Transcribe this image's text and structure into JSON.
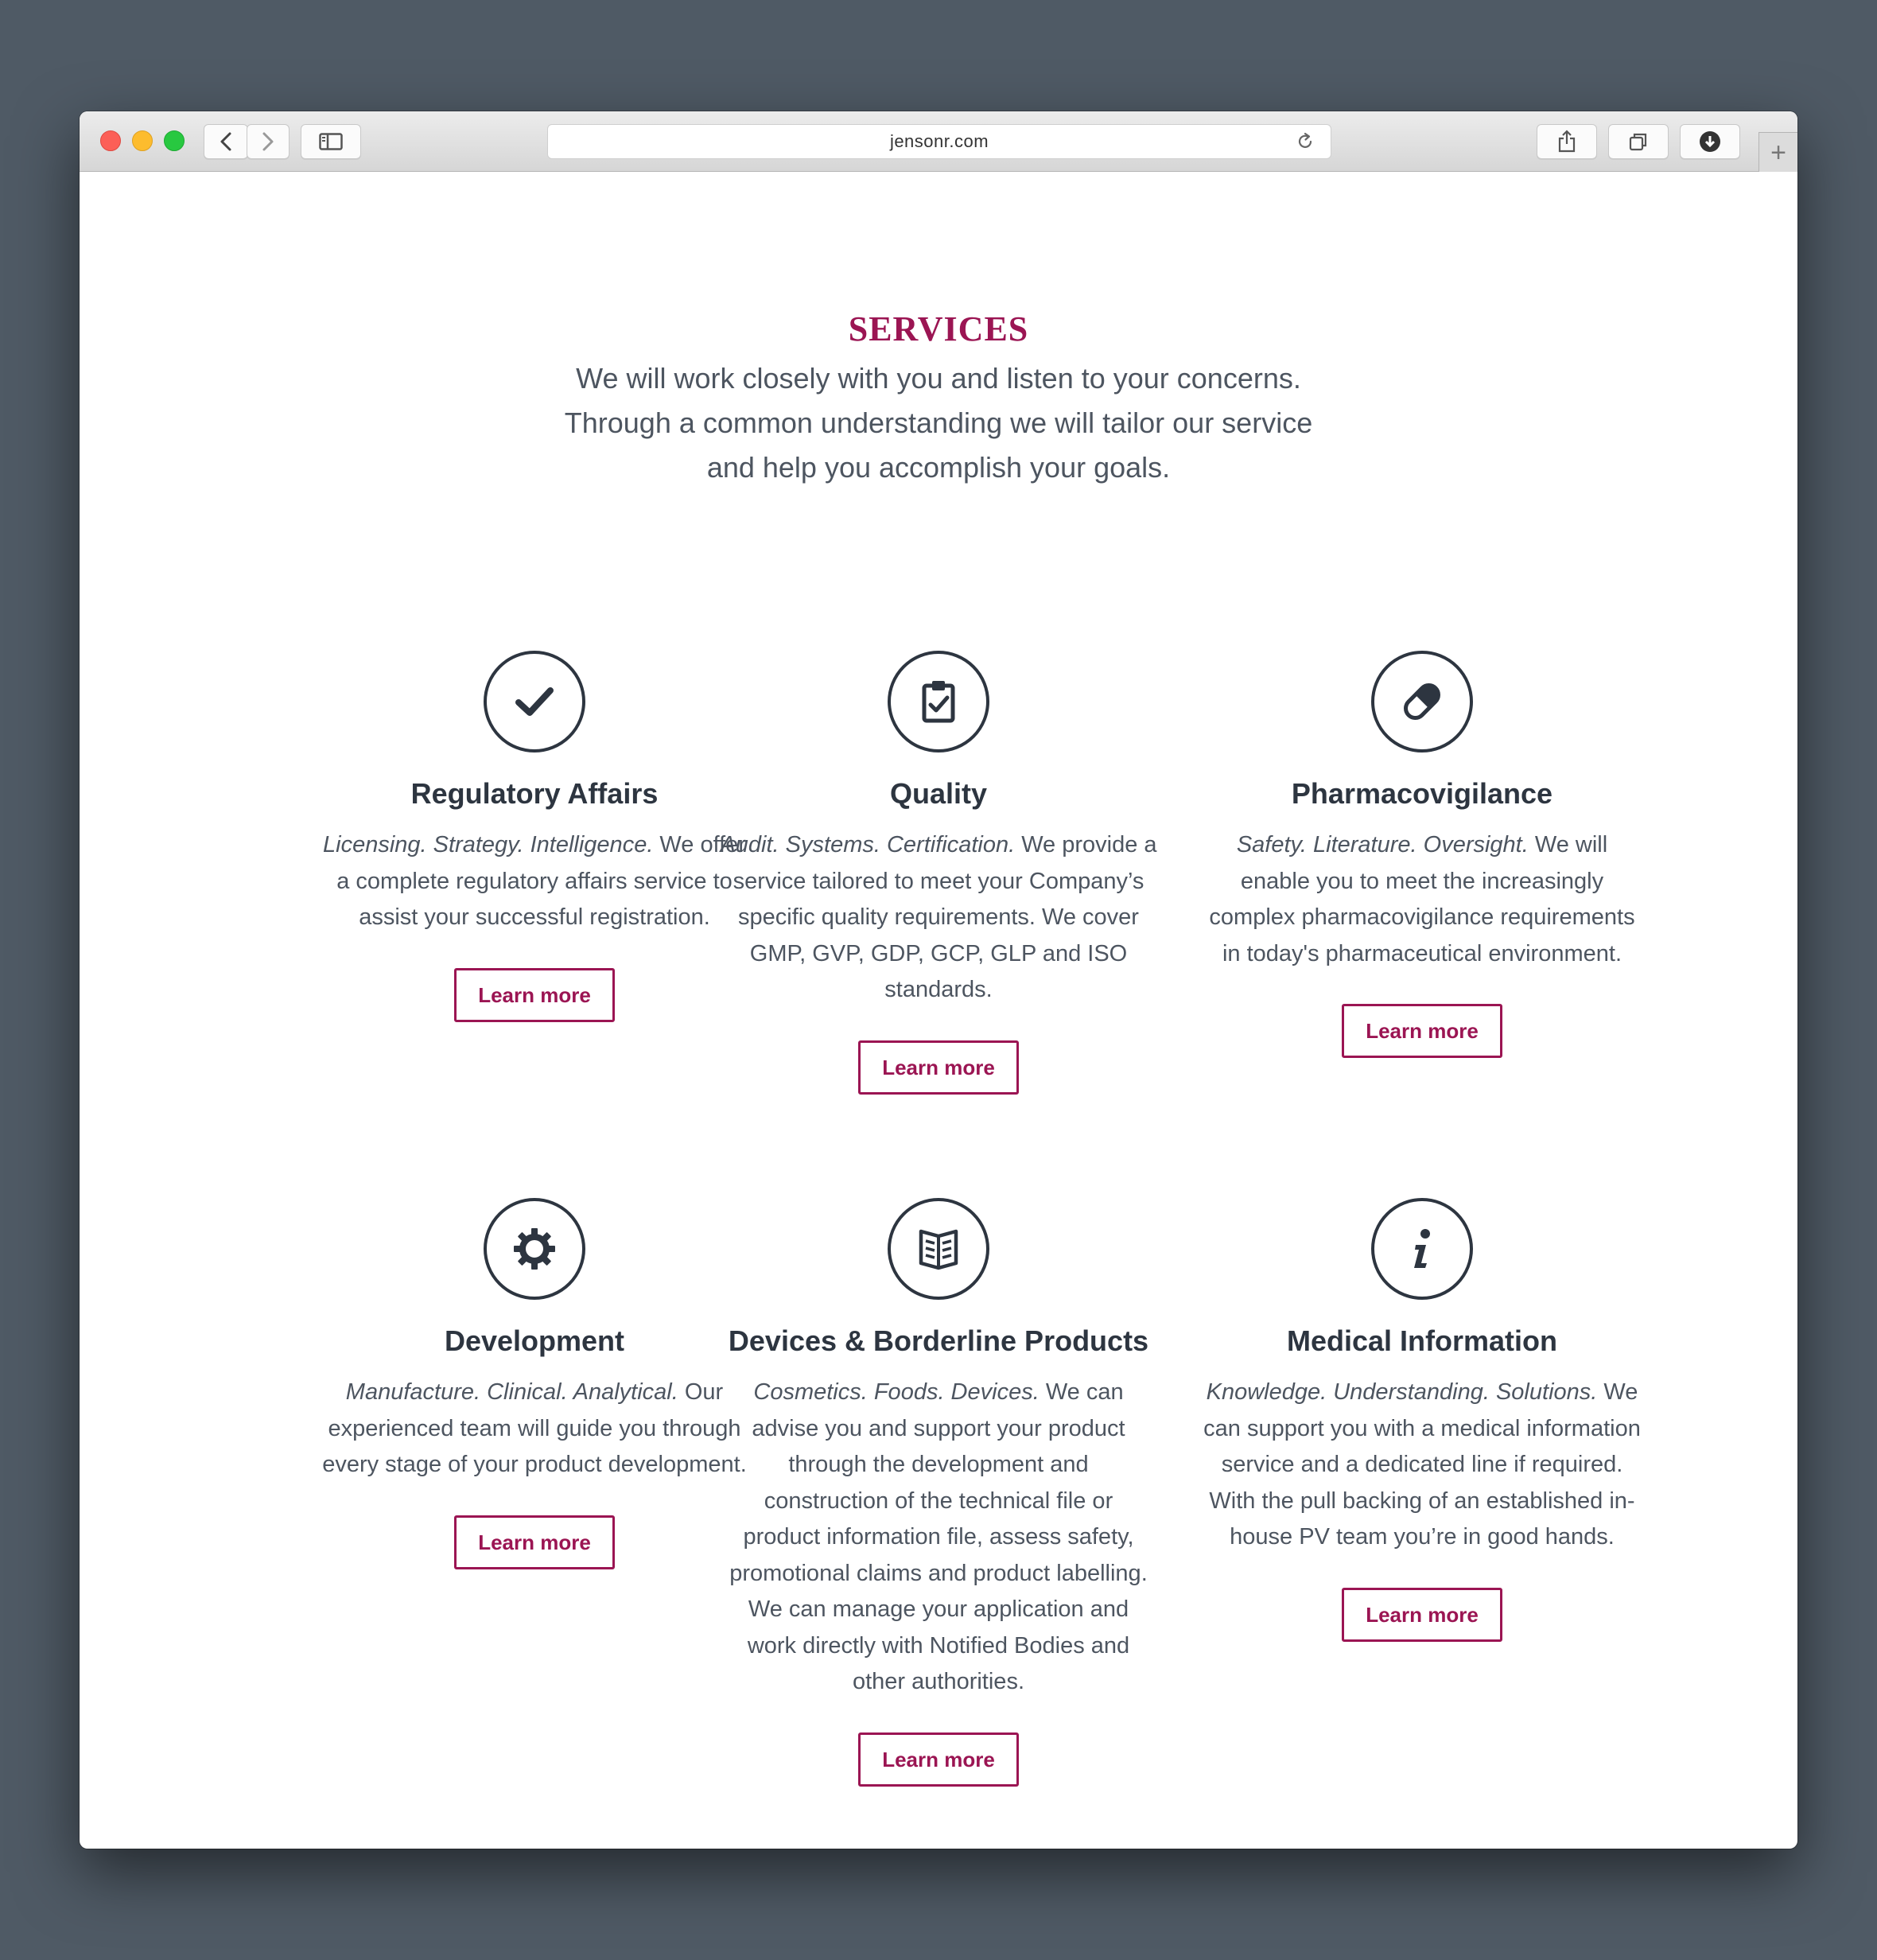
{
  "browser": {
    "url": "jensonr.com",
    "new_tab": "+"
  },
  "page": {
    "heading": "SERVICES",
    "intro": "We will work closely with you and listen to your concerns. Through a common understanding we will tailor our service and help you accomplish your goals."
  },
  "services": [
    {
      "icon": "check-icon",
      "title": "Regulatory Affairs",
      "tagline": "Licensing. Strategy. Intelligence.",
      "description": " We offer a complete regulatory affairs service to assist your successful registration.",
      "button": "Learn more"
    },
    {
      "icon": "clipboard-check-icon",
      "title": "Quality",
      "tagline": "Audit. Systems. Certification.",
      "description": " We provide a service tailored to meet your Company’s specific quality requirements. We cover GMP, GVP, GDP, GCP, GLP and ISO standards.",
      "button": "Learn more"
    },
    {
      "icon": "pill-icon",
      "title": "Pharmacovigilance",
      "tagline": "Safety. Literature. Oversight.",
      "description": " We will enable you to meet the increasingly complex pharmacovigilance requirements in today's pharmaceutical environment.",
      "button": "Learn more"
    },
    {
      "icon": "gear-icon",
      "title": "Development",
      "tagline": "Manufacture. Clinical. Analytical.",
      "description": " Our experienced team will guide you through every stage of your product development.",
      "button": "Learn more"
    },
    {
      "icon": "book-icon",
      "title": "Devices & Borderline Products",
      "tagline": "Cosmetics. Foods. Devices.",
      "description": " We can advise you and support your product through the development and construction of the technical file or product information file, assess safety, promotional claims and product labelling. We can manage your application and work directly with Notified Bodies and other authorities.",
      "button": "Learn more"
    },
    {
      "icon": "info-icon",
      "title": "Medical Information",
      "tagline": "Knowledge. Understanding. Solutions.",
      "description": " We can support you with a medical information service and a dedicated line if required. With the pull backing of an established in-house PV team you’re in good hands.",
      "button": "Learn more"
    }
  ]
}
